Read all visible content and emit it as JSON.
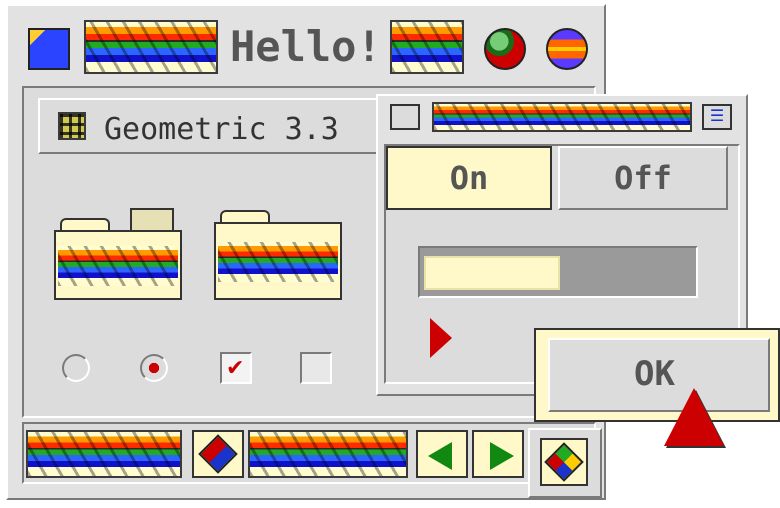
{
  "main_window": {
    "title": "Hello!",
    "control_panel_title": "Geometric 3.3",
    "icons": [
      "blue-cube-icon",
      "rainbow-arrow-strip",
      "rainbow-arrow-strip",
      "red-sphere-icon",
      "rainbow-sphere-icon",
      "grid-icon",
      "smiley-folder-icon",
      "rainbow-folder-icon",
      "rainbow-folder-arrow-icon"
    ],
    "checkboxes": [
      "radio-off",
      "radio-on",
      "checkbox-checked",
      "checkbox-unchecked"
    ]
  },
  "popup": {
    "segments": [
      {
        "label": "On",
        "selected": true
      },
      {
        "label": "Off",
        "selected": false
      }
    ],
    "progress": 0.5
  },
  "dialog": {
    "ok_label": "OK"
  },
  "colors": {
    "window_bg": "#dcdcdc",
    "cream": "#fff8c8",
    "accent_red": "#cc0000"
  }
}
